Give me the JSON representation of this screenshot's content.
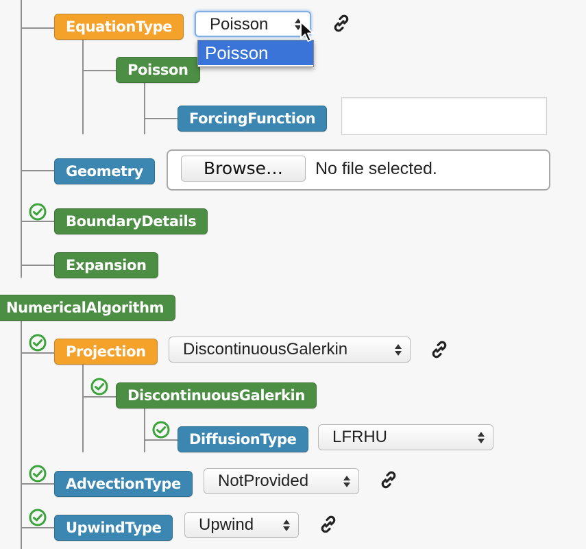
{
  "colors": {
    "orange": "#f4a22a",
    "green": "#4c8e43",
    "blue": "#3b87b2",
    "check": "#3aa33a",
    "dropdown_highlight": "#3a74d8"
  },
  "tree": {
    "equation_type": {
      "label": "EquationType",
      "select_value": "Poisson",
      "dropdown_options": [
        "Poisson"
      ]
    },
    "poisson": {
      "label": "Poisson"
    },
    "forcing_function": {
      "label": "ForcingFunction",
      "value": ""
    },
    "geometry": {
      "label": "Geometry",
      "browse_label": "Browse…",
      "file_status": "No file selected."
    },
    "boundary_details": {
      "label": "BoundaryDetails"
    },
    "expansion": {
      "label": "Expansion"
    },
    "numerical_algorithm": {
      "label": "NumericalAlgorithm"
    },
    "projection": {
      "label": "Projection",
      "select_value": "DiscontinuousGalerkin"
    },
    "discontinuous_galerkin": {
      "label": "DiscontinuousGalerkin"
    },
    "diffusion_type": {
      "label": "DiffusionType",
      "select_value": "LFRHU"
    },
    "advection_type": {
      "label": "AdvectionType",
      "select_value": "NotProvided"
    },
    "upwind_type": {
      "label": "UpwindType",
      "select_value": "Upwind"
    }
  },
  "icons": {
    "check": "check-circle-icon",
    "link": "chain-link-icon",
    "cursor": "mouse-pointer-icon",
    "select_arrows": "up-down-arrows-icon"
  }
}
